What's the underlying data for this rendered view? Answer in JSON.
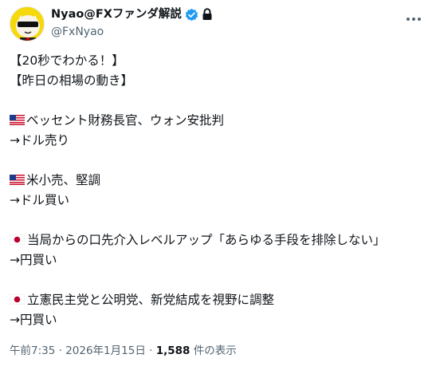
{
  "header": {
    "display_name": "Nyao@FXファンダ解説",
    "handle": "@FxNyao"
  },
  "tweet": {
    "lines": [
      "【20秒でわかる！】",
      "【昨日の相場の動き】",
      "",
      "ベッセント財務長官、ウォン安批判",
      "→ドル売り",
      "",
      "米小売、堅調",
      "→ドル買い",
      "",
      "当局からの口先介入レベルアップ「あらゆる手段を排除しない」",
      "→円買い",
      "",
      "立憲民主党と公明党、新党結成を視野に調整",
      "→円買い"
    ],
    "flags": {
      "line3": "us-flag",
      "line6": "us-flag",
      "line9": "jp-flag",
      "line12": "jp-flag"
    }
  },
  "meta": {
    "time": "午前7:35",
    "separator": " · ",
    "date": "2026年1月15日",
    "views": "1,588",
    "views_suffix": " 件の表示"
  },
  "colors": {
    "verified": "#1d9bf0",
    "text": "#0f1419",
    "secondary": "#536471"
  }
}
